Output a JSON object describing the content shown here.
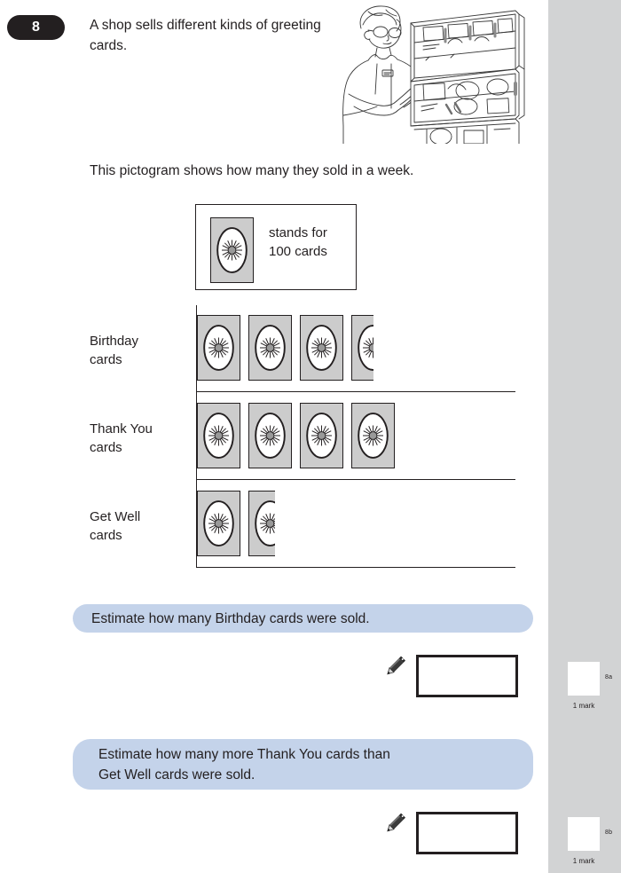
{
  "question": {
    "number": "8",
    "intro": "A shop sells different kinds of greeting cards.",
    "pictogram_intro": "This pictogram shows how many they sold in a week."
  },
  "illustration": {
    "name": "person-browsing-greeting-card-rack",
    "description": "Line drawing of a person with glasses standing at an open greeting card display stand, reaching for a card."
  },
  "key": {
    "symbol_name": "card-symbol",
    "text": "stands for\n100 cards",
    "line1": "stands for",
    "line2": "100 cards",
    "value": 100
  },
  "chart_data": {
    "type": "pictogram",
    "title": "This pictogram shows how many they sold in a week.",
    "key_label": "stands for 100 cards",
    "symbol_value": 100,
    "xlabel": "",
    "ylabel": "",
    "categories": [
      "Birthday cards",
      "Thank You cards",
      "Get Well cards"
    ],
    "values": [
      330,
      400,
      140
    ],
    "symbols": [
      3.3,
      4,
      1.4
    ],
    "rows": [
      {
        "label_line1": "Birthday",
        "label_line2": "cards",
        "full_symbols": 3,
        "partial_fraction": 0.3,
        "estimated_value": 330
      },
      {
        "label_line1": "Thank You",
        "label_line2": "cards",
        "full_symbols": 4,
        "partial_fraction": 0,
        "estimated_value": 400
      },
      {
        "label_line1": "Get Well",
        "label_line2": "cards",
        "full_symbols": 1,
        "partial_fraction": 0.4,
        "estimated_value": 140
      }
    ]
  },
  "parts": [
    {
      "id": "8a",
      "prompt_line1": "Estimate how many Birthday cards were sold.",
      "prompt_line2": "",
      "answer_value": "",
      "answer_placeholder": "",
      "marks": "1 mark"
    },
    {
      "id": "8b",
      "prompt_line1": "Estimate how many more Thank You cards than",
      "prompt_line2": "Get Well cards were sold.",
      "answer_value": "",
      "answer_placeholder": "",
      "marks": "1 mark"
    }
  ],
  "colors": {
    "badge_bg": "#231f20",
    "banner_bg": "#c4d3ea",
    "symbol_fill": "#cccccc",
    "margin_bg": "#d2d3d4",
    "ink": "#231f20"
  }
}
